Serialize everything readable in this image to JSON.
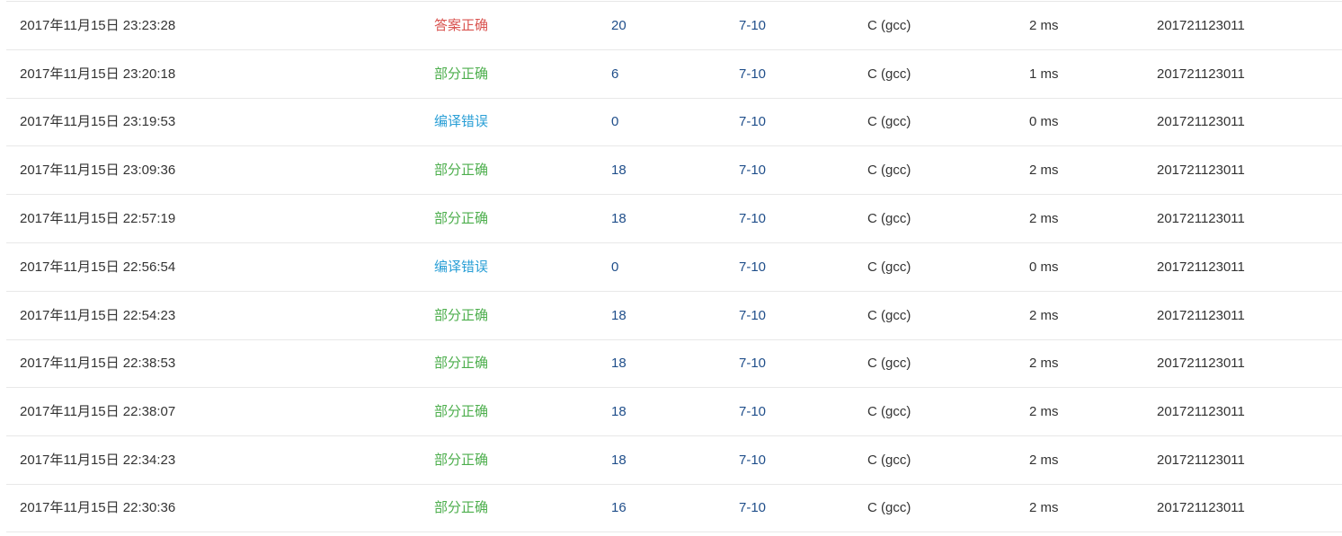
{
  "colors": {
    "accepted": "#d9534f",
    "partially_accepted": "#4cae4c",
    "compile_error": "#2a9fd6",
    "link": "#1f4e8a",
    "text": "#333333",
    "divider": "#e8e8e8"
  },
  "submissions": [
    {
      "time": "2017年11月15日 23:23:28",
      "status": "答案正确",
      "status_type": "accepted",
      "score": "20",
      "problem": "7-10",
      "compiler": "C (gcc)",
      "time_cost": "2 ms",
      "user": "201721123011"
    },
    {
      "time": "2017年11月15日 23:20:18",
      "status": "部分正确",
      "status_type": "partially_accepted",
      "score": "6",
      "problem": "7-10",
      "compiler": "C (gcc)",
      "time_cost": "1 ms",
      "user": "201721123011"
    },
    {
      "time": "2017年11月15日 23:19:53",
      "status": "编译错误",
      "status_type": "compile_error",
      "score": "0",
      "problem": "7-10",
      "compiler": "C (gcc)",
      "time_cost": "0 ms",
      "user": "201721123011"
    },
    {
      "time": "2017年11月15日 23:09:36",
      "status": "部分正确",
      "status_type": "partially_accepted",
      "score": "18",
      "problem": "7-10",
      "compiler": "C (gcc)",
      "time_cost": "2 ms",
      "user": "201721123011"
    },
    {
      "time": "2017年11月15日 22:57:19",
      "status": "部分正确",
      "status_type": "partially_accepted",
      "score": "18",
      "problem": "7-10",
      "compiler": "C (gcc)",
      "time_cost": "2 ms",
      "user": "201721123011"
    },
    {
      "time": "2017年11月15日 22:56:54",
      "status": "编译错误",
      "status_type": "compile_error",
      "score": "0",
      "problem": "7-10",
      "compiler": "C (gcc)",
      "time_cost": "0 ms",
      "user": "201721123011"
    },
    {
      "time": "2017年11月15日 22:54:23",
      "status": "部分正确",
      "status_type": "partially_accepted",
      "score": "18",
      "problem": "7-10",
      "compiler": "C (gcc)",
      "time_cost": "2 ms",
      "user": "201721123011"
    },
    {
      "time": "2017年11月15日 22:38:53",
      "status": "部分正确",
      "status_type": "partially_accepted",
      "score": "18",
      "problem": "7-10",
      "compiler": "C (gcc)",
      "time_cost": "2 ms",
      "user": "201721123011"
    },
    {
      "time": "2017年11月15日 22:38:07",
      "status": "部分正确",
      "status_type": "partially_accepted",
      "score": "18",
      "problem": "7-10",
      "compiler": "C (gcc)",
      "time_cost": "2 ms",
      "user": "201721123011"
    },
    {
      "time": "2017年11月15日 22:34:23",
      "status": "部分正确",
      "status_type": "partially_accepted",
      "score": "18",
      "problem": "7-10",
      "compiler": "C (gcc)",
      "time_cost": "2 ms",
      "user": "201721123011"
    },
    {
      "time": "2017年11月15日 22:30:36",
      "status": "部分正确",
      "status_type": "partially_accepted",
      "score": "16",
      "problem": "7-10",
      "compiler": "C (gcc)",
      "time_cost": "2 ms",
      "user": "201721123011"
    }
  ]
}
